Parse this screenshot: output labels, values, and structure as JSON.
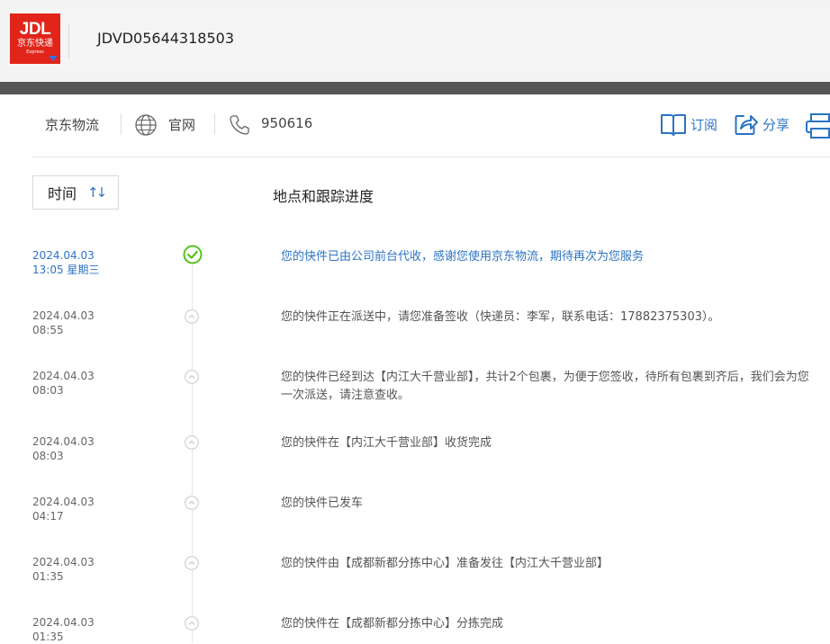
{
  "header": {
    "logo": {
      "line1": "JDL",
      "line2": "京东快递",
      "line3": "Express"
    },
    "tracking_number": "JDVD05644318503"
  },
  "info_bar": {
    "carrier": "京东物流",
    "website_label": "官网",
    "phone": "950616",
    "subscribe_label": "订阅",
    "share_label": "分享"
  },
  "table": {
    "time_header": "时间",
    "location_header": "地点和跟踪进度"
  },
  "events": [
    {
      "date": "2024.04.03",
      "time": "13:05 星期三",
      "text": "您的快件已由公司前台代收，感谢您使用京东物流，期待再次为您服务"
    },
    {
      "date": "2024.04.03",
      "time": "08:55",
      "text": "您的快件正在派送中，请您准备签收（快递员：李军，联系电话：17882375303）。"
    },
    {
      "date": "2024.04.03",
      "time": "08:03",
      "text": "您的快件已经到达【内江大千营业部】，共计2个包裹，为便于您签收，待所有包裹到齐后，我们会为您一次派送，请注意查收。"
    },
    {
      "date": "2024.04.03",
      "time": "08:03",
      "text": "您的快件在【内江大千营业部】收货完成"
    },
    {
      "date": "2024.04.03",
      "time": "04:17",
      "text": "您的快件已发车"
    },
    {
      "date": "2024.04.03",
      "time": "01:35",
      "text": "您的快件由【成都新都分拣中心】准备发往【内江大千营业部】"
    },
    {
      "date": "2024.04.03",
      "time": "01:35",
      "text": "您的快件在【成都新都分拣中心】分拣完成"
    }
  ],
  "colors": {
    "brand_red": "#e1251b",
    "link_blue": "#2b73c5",
    "success_green": "#52c41a"
  }
}
